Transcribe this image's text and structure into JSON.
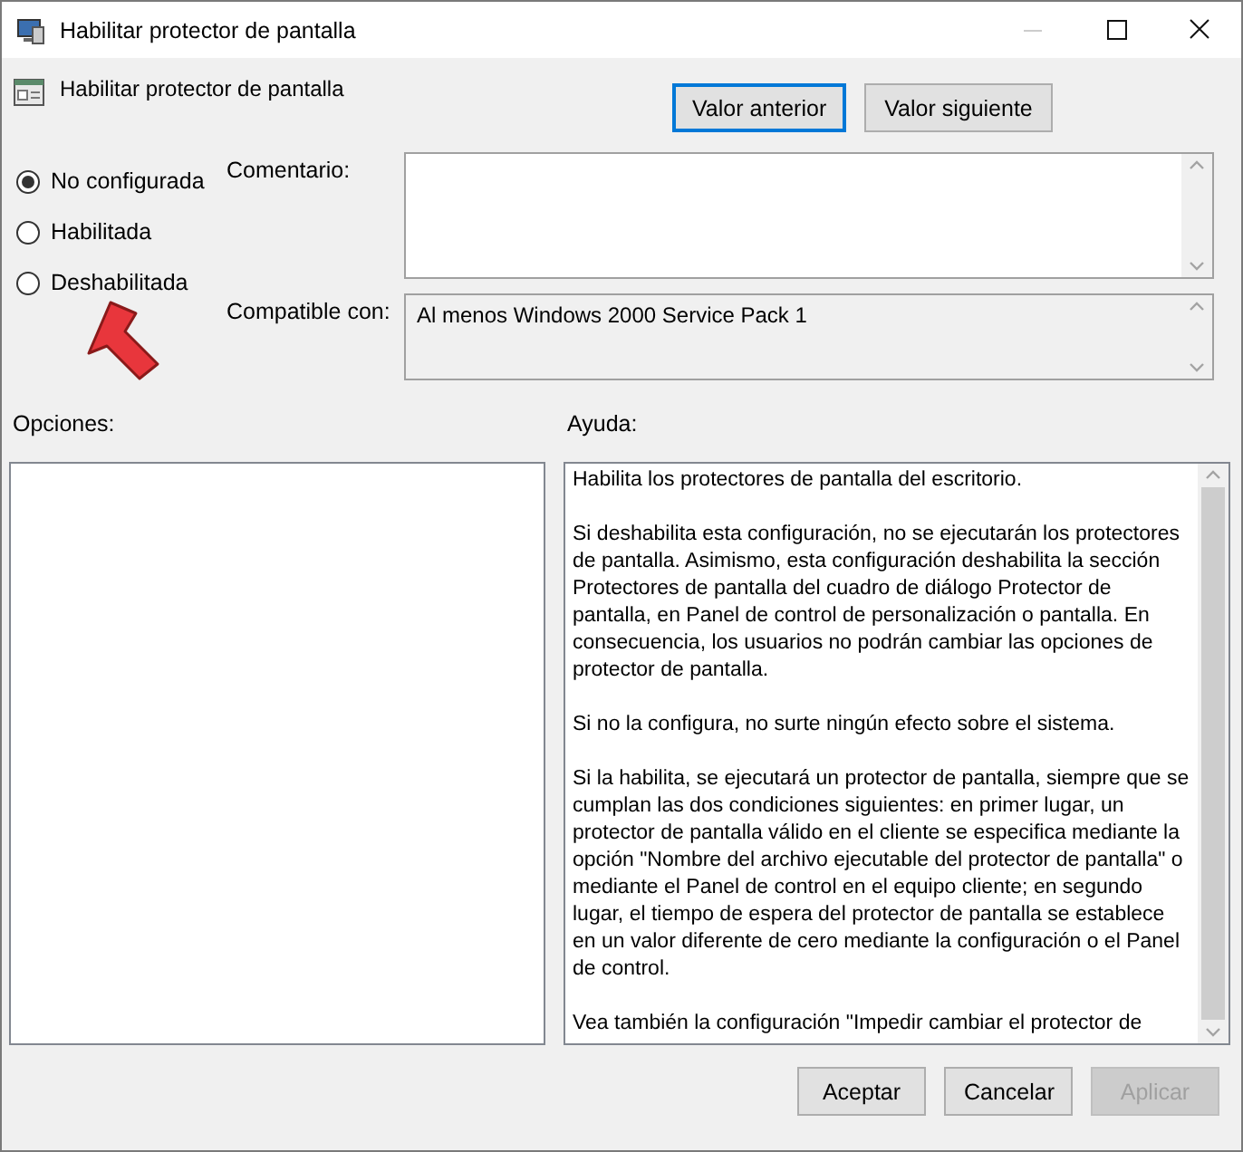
{
  "window": {
    "title": "Habilitar protector de pantalla"
  },
  "setting": {
    "title": "Habilitar protector de pantalla"
  },
  "nav_buttons": [
    {
      "label": "Valor anterior",
      "focused": true
    },
    {
      "label": "Valor siguiente",
      "focused": false
    }
  ],
  "state_options": [
    {
      "label": "No configurada",
      "selected": true
    },
    {
      "label": "Habilitada",
      "selected": false
    },
    {
      "label": "Deshabilitada",
      "selected": false
    }
  ],
  "comment": {
    "label": "Comentario:"
  },
  "compatible": {
    "label": "Compatible con:",
    "value": "Al menos Windows 2000 Service Pack 1"
  },
  "options": {
    "label": "Opciones:"
  },
  "help": {
    "label": "Ayuda:",
    "paragraphs": [
      "Habilita los protectores de pantalla del escritorio.",
      "Si deshabilita esta configuración, no se ejecutarán los protectores de pantalla. Asimismo, esta configuración deshabilita la sección Protectores de pantalla del cuadro de diálogo Protector de pantalla, en Panel de control de personalización o pantalla. En consecuencia, los usuarios no podrán cambiar las opciones de protector de pantalla.",
      "Si no la configura, no surte ningún efecto sobre el sistema.",
      "Si la habilita, se ejecutará un protector de pantalla, siempre que se cumplan las dos condiciones siguientes: en primer lugar, un protector de pantalla válido en el cliente se especifica mediante la opción \"Nombre del archivo ejecutable del protector de pantalla\" o mediante el Panel de control en el equipo cliente; en segundo lugar, el tiempo de espera del protector de pantalla se establece en un valor diferente de cero mediante la configuración o el Panel de control.",
      "Vea también la configuración \"Impedir cambiar el protector de"
    ]
  },
  "footer_buttons": [
    {
      "label": "Aceptar",
      "disabled": false
    },
    {
      "label": "Cancelar",
      "disabled": false
    },
    {
      "label": "Aplicar",
      "disabled": true
    }
  ]
}
